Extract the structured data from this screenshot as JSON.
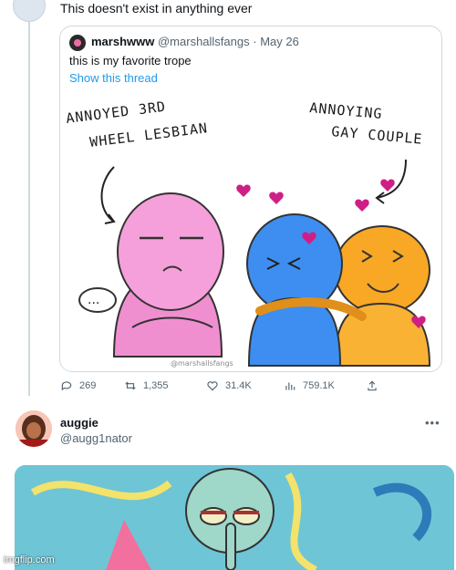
{
  "top_tweet": {
    "text": "This doesn't exist in anything ever"
  },
  "quote": {
    "name": "marshwww",
    "handle": "@marshallsfangs",
    "date": "May 26",
    "text": "this is my favorite trope",
    "show_thread": "Show this thread",
    "art": {
      "label_left_1": "ANNOYED 3RD",
      "label_left_2": "WHEEL LESBIAN",
      "label_right_1": "ANNOYING",
      "label_right_2": "GAY COUPLE",
      "speech": "...",
      "signature": "@marshallsfangs"
    }
  },
  "actions": {
    "replies": "269",
    "retweets": "1,355",
    "likes": "31.4K",
    "views": "759.1K"
  },
  "reply": {
    "name": "auggie",
    "handle": "@augg1nator"
  },
  "watermark": "imgflip.com",
  "colors": {
    "link": "#1d9bf0",
    "secondary": "#536471",
    "like_heart": "#e0245e"
  }
}
